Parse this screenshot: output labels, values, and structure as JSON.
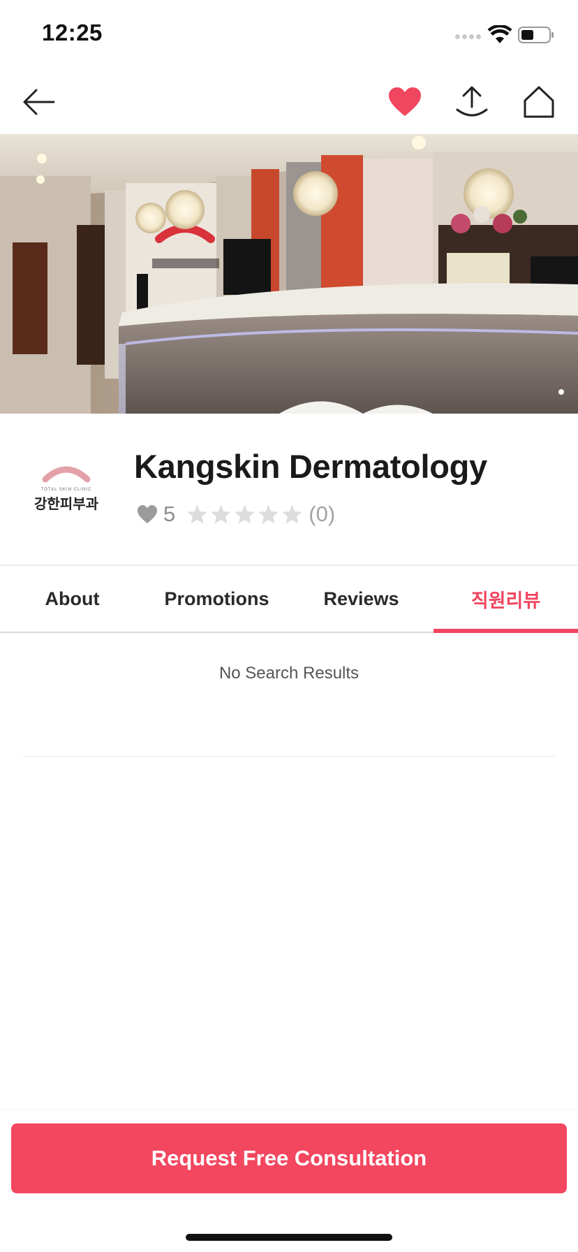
{
  "status_bar": {
    "time": "12:25"
  },
  "nav": {
    "icons": [
      "back-arrow-icon",
      "heart-icon",
      "share-icon",
      "home-icon"
    ],
    "favorite_color": "#f0465f"
  },
  "clinic": {
    "name": "Kangskin Dermatology",
    "logo_text": "강한피부과",
    "logo_subtext": "TOTAL SKIN CLINIC",
    "likes": "5",
    "rating_stars": 0,
    "review_count": "(0)"
  },
  "tabs": [
    {
      "label": "About",
      "active": false
    },
    {
      "label": "Promotions",
      "active": false
    },
    {
      "label": "Reviews",
      "active": false
    },
    {
      "label": "직원리뷰",
      "active": true
    }
  ],
  "content": {
    "empty_message": "No Search Results"
  },
  "cta": {
    "label": "Request Free Consultation"
  },
  "colors": {
    "accent": "#f0465f",
    "text_muted": "#8d8d8d"
  }
}
